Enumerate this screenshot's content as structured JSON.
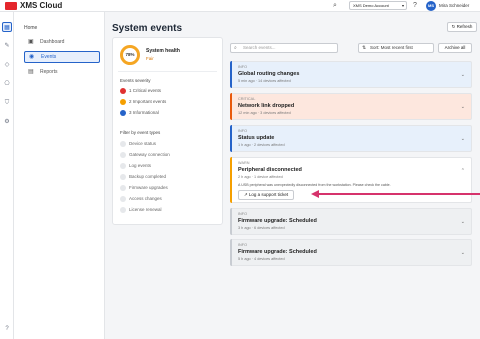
{
  "topbar": {
    "brand": "XMS Cloud",
    "account": "XMS Demo Account",
    "user_initials": "MS",
    "user_name": "Mira Schneider"
  },
  "rail": {
    "items": [
      {
        "icon": "dashboard-icon",
        "glyph": "▦",
        "active": true
      },
      {
        "icon": "wrench-icon",
        "glyph": "✎",
        "active": false
      },
      {
        "icon": "tag-icon",
        "glyph": "◇",
        "active": false
      },
      {
        "icon": "network-icon",
        "glyph": "⎔",
        "active": false
      },
      {
        "icon": "shield-icon",
        "glyph": "⛉",
        "active": false
      },
      {
        "icon": "gear-icon",
        "glyph": "⚙",
        "active": false
      }
    ],
    "help_glyph": "?"
  },
  "sidenav": {
    "heading": "Home",
    "items": [
      {
        "label": "Dashboard",
        "glyph": "▣",
        "active": false
      },
      {
        "label": "Events",
        "glyph": "◉",
        "active": true
      },
      {
        "label": "Reports",
        "glyph": "▤",
        "active": false
      }
    ]
  },
  "page": {
    "title": "System events",
    "refresh_label": "↻ Refresh"
  },
  "summary": {
    "score": "78%",
    "health_label": "System health",
    "health_status": "Fair",
    "severity_title": "Events severity",
    "severity": [
      {
        "label": "1 Critical events",
        "color": "#e03131"
      },
      {
        "label": "2 Important events",
        "color": "#f59f00"
      },
      {
        "label": "3 Informational",
        "color": "#2563c9"
      }
    ],
    "filter_title": "Filter by event types",
    "filters": [
      "Device status",
      "Gateway connection",
      "Log events",
      "Backup completed",
      "Firmware upgrades",
      "Access changes",
      "License renewal"
    ]
  },
  "toolbar": {
    "search_placeholder": "Search events...",
    "sort_label": "Sort: Most recent first",
    "archive_label": "Archive all"
  },
  "events": [
    {
      "type": "INFO",
      "title": "Global routing changes",
      "sub": "5 min ago · 14 devices affected",
      "accent": "#2563c9",
      "bg": "#e7f0fb"
    },
    {
      "type": "CRITICAL",
      "title": "Network link dropped",
      "sub": "12 min ago · 3 devices affected",
      "accent": "#e8590c",
      "bg": "#fde7de"
    },
    {
      "type": "INFO",
      "title": "Status update",
      "sub": "1 h ago · 2 devices affected",
      "accent": "#2563c9",
      "bg": "#e7f0fb"
    },
    {
      "type": "WARN",
      "title": "Peripheral disconnected",
      "sub": "2 h ago · 1 device affected",
      "accent": "#f59f00",
      "bg": "#ffffff",
      "desc": "A USB peripheral was unexpectedly disconnected from the workstation. Please check the cable.",
      "action": "↗ Log a support ticket"
    },
    {
      "type": "INFO",
      "title": "Firmware upgrade: Scheduled",
      "sub": "3 h ago · 6 devices affected",
      "accent": "#c8ccd2",
      "bg": "#eef0f2"
    },
    {
      "type": "INFO",
      "title": "Firmware upgrade: Scheduled",
      "sub": "5 h ago · 4 devices affected",
      "accent": "#c8ccd2",
      "bg": "#eef0f2"
    }
  ],
  "colors": {
    "brand": "#e4262c",
    "accent": "#2563c9",
    "pointer": "#d6336c"
  }
}
